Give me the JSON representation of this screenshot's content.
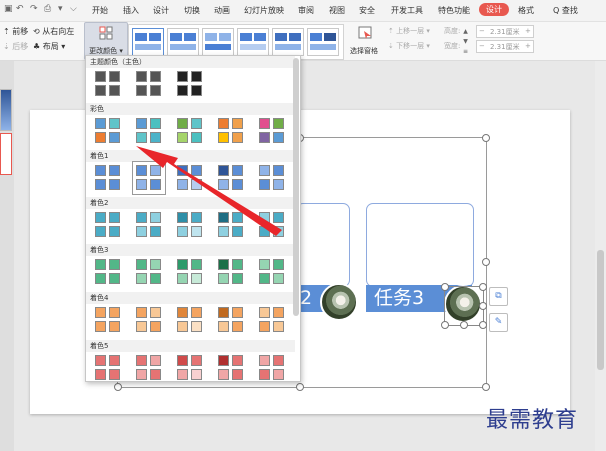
{
  "quick_access": {
    "icons": [
      "file-icon",
      "undo-icon",
      "redo-icon",
      "print-icon",
      "expand-icon"
    ]
  },
  "menu_tabs": [
    {
      "label": "开始"
    },
    {
      "label": "插入"
    },
    {
      "label": "设计"
    },
    {
      "label": "切换"
    },
    {
      "label": "动画"
    },
    {
      "label": "幻灯片放映"
    },
    {
      "label": "审阅"
    },
    {
      "label": "视图"
    },
    {
      "label": "安全"
    },
    {
      "label": "开发工具"
    },
    {
      "label": "特色功能"
    },
    {
      "label": "设计"
    },
    {
      "label": "格式"
    }
  ],
  "active_tab_color": "#e8584f",
  "search_label": "Q 查找",
  "ribbon": {
    "forward_label": "前移",
    "backward_label": "后移",
    "direction_label": "从右向左",
    "layout_label": "布局",
    "change_color_label": "更改颜色",
    "select_pane_label": "选择窗格",
    "move_up_label": "上移一层",
    "move_down_label": "下移一层",
    "height_label": "高度:",
    "width_label": "宽度:",
    "height_value": "2.31厘米",
    "width_value": "2.31厘米"
  },
  "dropdown": {
    "sections": [
      {
        "title": "主题颜色（主色）",
        "rows": [
          [
            [
              "#555",
              "#555",
              "#555",
              "#555"
            ],
            [
              "#555",
              "#555",
              "#555",
              "#555"
            ],
            [
              "#222",
              "#222",
              "#222",
              "#222"
            ]
          ]
        ]
      },
      {
        "title": "彩色",
        "rows": [
          [
            [
              "#5b9bd5",
              "#5fc4c9",
              "#ed7d31",
              "#5b9bd5"
            ],
            [
              "#5b9bd5",
              "#4bc0c0",
              "#5fc4c9",
              "#4bb3c9"
            ],
            [
              "#70ad47",
              "#5fc4c9",
              "#a5d46a",
              "#4bc0c0"
            ],
            [
              "#ed7d31",
              "#f0a04b",
              "#ffc000",
              "#f0a04b"
            ],
            [
              "#e14e8e",
              "#70ad47",
              "#8064a2",
              "#5b9bd5"
            ]
          ]
        ]
      },
      {
        "title": "着色1",
        "rows": [
          [
            [
              "#5b8ed6",
              "#5b8ed6",
              "#5b8ed6",
              "#5b8ed6"
            ],
            [
              "#5b8ed6",
              "#8fb3e8",
              "#8fb3e8",
              "#5b8ed6"
            ],
            [
              "#3f6fbf",
              "#5b8ed6",
              "#8fb3e8",
              "#b6cdf0"
            ],
            [
              "#2f5597",
              "#5b8ed6",
              "#8fb3e8",
              "#5b8ed6"
            ],
            [
              "#8fb3e8",
              "#5b8ed6",
              "#5b8ed6",
              "#8fb3e8"
            ]
          ]
        ]
      },
      {
        "title": "着色2",
        "rows": [
          [
            [
              "#4bacc6",
              "#4bacc6",
              "#4bacc6",
              "#4bacc6"
            ],
            [
              "#4bacc6",
              "#8ed0e0",
              "#8ed0e0",
              "#4bacc6"
            ],
            [
              "#2e8fa8",
              "#4bacc6",
              "#8ed0e0",
              "#bfe4ee"
            ],
            [
              "#1f6e84",
              "#4bacc6",
              "#8ed0e0",
              "#4bacc6"
            ],
            [
              "#8ed0e0",
              "#4bacc6",
              "#4bacc6",
              "#8ed0e0"
            ]
          ]
        ]
      },
      {
        "title": "着色3",
        "rows": [
          [
            [
              "#52b788",
              "#52b788",
              "#52b788",
              "#52b788"
            ],
            [
              "#52b788",
              "#95d5b2",
              "#95d5b2",
              "#52b788"
            ],
            [
              "#2d9a6a",
              "#52b788",
              "#95d5b2",
              "#c7ead8"
            ],
            [
              "#1b7048",
              "#52b788",
              "#95d5b2",
              "#52b788"
            ],
            [
              "#95d5b2",
              "#52b788",
              "#52b788",
              "#95d5b2"
            ]
          ]
        ]
      },
      {
        "title": "着色4",
        "rows": [
          [
            [
              "#f4a460",
              "#f4a460",
              "#f4a460",
              "#f4a460"
            ],
            [
              "#f4a460",
              "#f8c896",
              "#f8c896",
              "#f4a460"
            ],
            [
              "#e0863a",
              "#f4a460",
              "#f8c896",
              "#fbe0c4"
            ],
            [
              "#c06a20",
              "#f4a460",
              "#f8c896",
              "#f4a460"
            ],
            [
              "#f8c896",
              "#f4a460",
              "#f4a460",
              "#f8c896"
            ]
          ]
        ]
      },
      {
        "title": "着色5",
        "rows": [
          [
            [
              "#e57373",
              "#e57373",
              "#e57373",
              "#e57373"
            ],
            [
              "#e57373",
              "#f0a6a6",
              "#f0a6a6",
              "#e57373"
            ],
            [
              "#d04b4b",
              "#e57373",
              "#f0a6a6",
              "#f8d0d0"
            ],
            [
              "#b03030",
              "#e57373",
              "#f0a6a6",
              "#e57373"
            ],
            [
              "#f0a6a6",
              "#e57373",
              "#e57373",
              "#f0a6a6"
            ]
          ]
        ]
      }
    ]
  },
  "slide": {
    "card1_text": "2",
    "card2_text": "任务3",
    "card_bar_color": "#5b8ed6"
  },
  "watermark": "最需教育",
  "arrow_color": "#e8262a"
}
